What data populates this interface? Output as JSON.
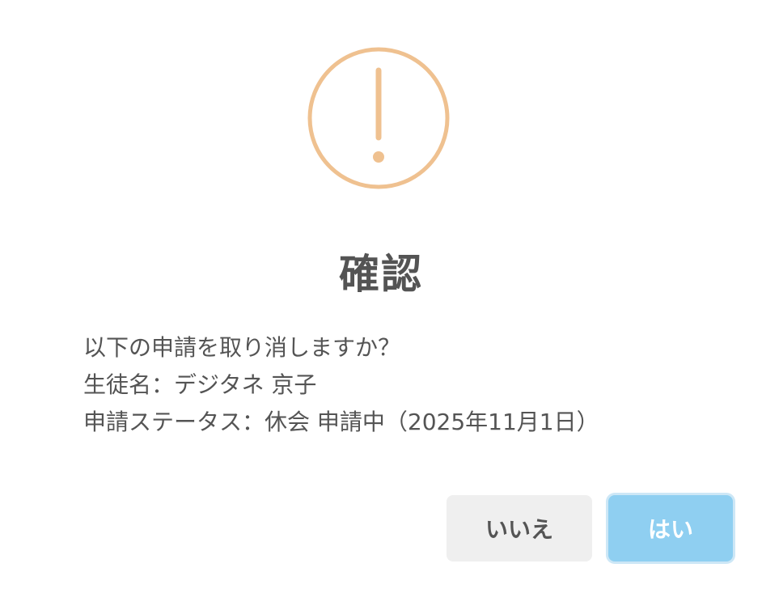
{
  "dialog": {
    "icon": "warning-icon",
    "icon_color": "#efc190",
    "title": "確認",
    "message_lines": [
      "以下の申請を取り消しますか？",
      "生徒名：デジタネ 京子",
      "申請ステータス：休会 申請中（2025年11月1日）"
    ],
    "buttons": {
      "cancel_label": "いいえ",
      "confirm_label": "はい"
    },
    "colors": {
      "text": "#545454",
      "cancel_bg": "#efefef",
      "confirm_bg": "#8fcff1",
      "confirm_focus_ring": "#cde7f6"
    }
  }
}
